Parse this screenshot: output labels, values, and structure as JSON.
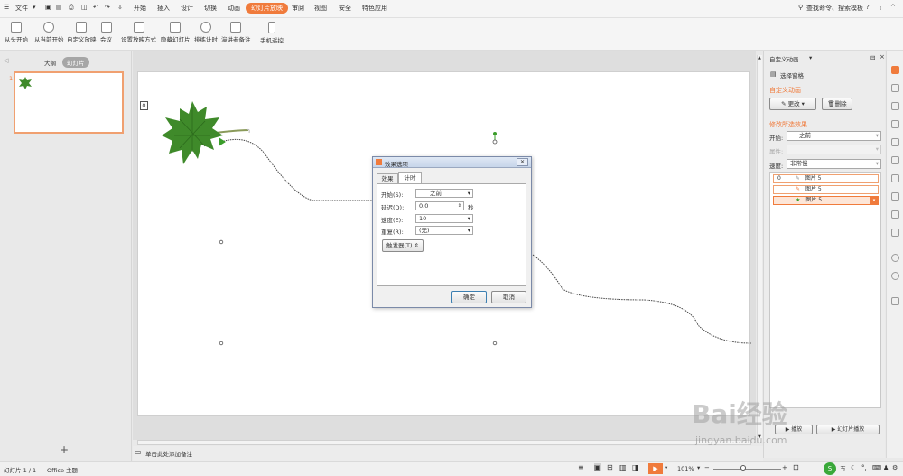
{
  "menu": {
    "file_label": "文件",
    "tabs": [
      "开始",
      "插入",
      "设计",
      "切换",
      "动画",
      "幻灯片放映",
      "审阅",
      "视图",
      "安全",
      "特色应用"
    ],
    "active_tab_index": 5,
    "search_label": "查找命令、搜索模板"
  },
  "ribbon": {
    "buttons": [
      "从头开始",
      "从当前开始",
      "自定义放映",
      "会议",
      "设置放映方式",
      "隐藏幻灯片",
      "排练计时",
      "演讲者备注",
      "手机遥控"
    ]
  },
  "left_panel": {
    "tab_outline": "大纲",
    "tab_slides": "幻灯片",
    "thumb_number": "1",
    "add_symbol": "+"
  },
  "slide": {
    "anim_tag": "0"
  },
  "notes": {
    "placeholder": "单击此处添加备注"
  },
  "dialog": {
    "title": "效果选项",
    "close_symbol": "✕",
    "tabs": [
      "效果",
      "计时"
    ],
    "start_label": "开始(S):",
    "start_value": "之前",
    "delay_label": "延迟(D):",
    "delay_value": "0.0",
    "delay_unit": "秒",
    "speed_label": "速度(E):",
    "speed_value": "10",
    "repeat_label": "重复(R):",
    "repeat_value": "(无)",
    "trigger_label": "触发器(T)",
    "ok_label": "确定",
    "cancel_label": "取消"
  },
  "custom_anim": {
    "pane_title": "自定义动画",
    "select_pane": "选择窗格",
    "section_custom": "自定义动画",
    "change_btn": "更改",
    "delete_btn": "删除",
    "section_modify": "修改所选效果",
    "start_label": "开始:",
    "start_value": "之前",
    "property_label": "属性:",
    "speed_label": "速度:",
    "speed_value": "非常慢",
    "list_items": [
      {
        "index": "0",
        "name": "图片 5"
      },
      {
        "index": "",
        "name": "图片 5"
      },
      {
        "index": "",
        "name": "图片 5"
      }
    ],
    "play_btn": "播放",
    "slideshow_btn": "幻灯片播放"
  },
  "statusbar": {
    "slide_info": "幻灯片 1 / 1",
    "theme": "Office 主题",
    "zoom": "101%"
  },
  "watermark": {
    "baidu_text": "Bai经验",
    "url": "jingyan.baidu.com"
  },
  "colors": {
    "accent": "#f07b3c",
    "leaf_green": "#3f8a2a",
    "motion_path": "#444444"
  }
}
